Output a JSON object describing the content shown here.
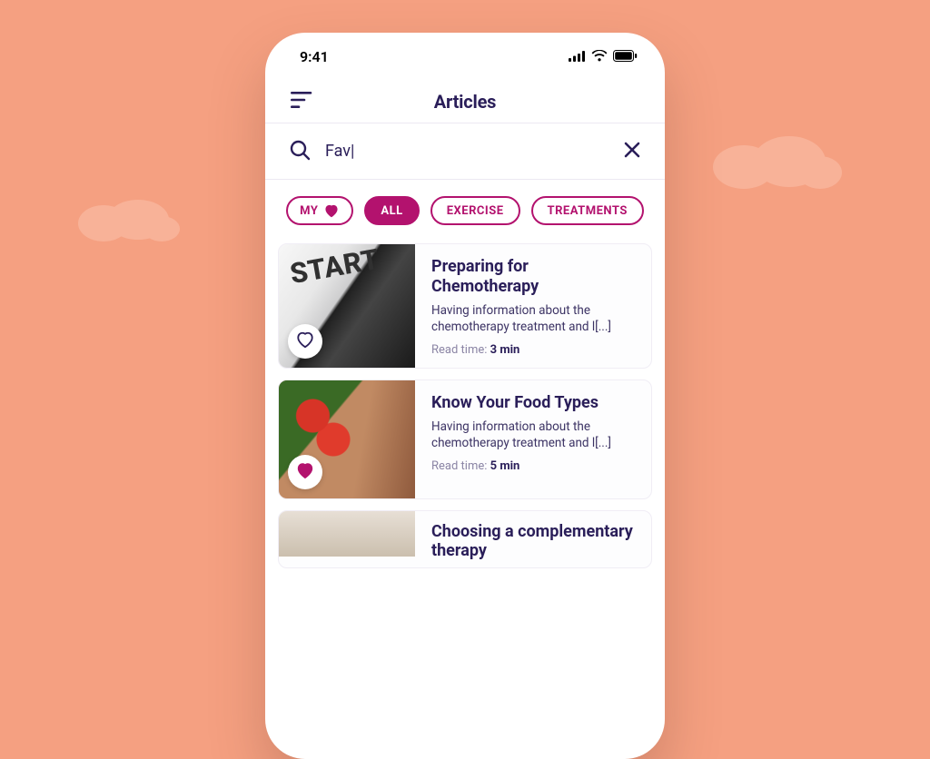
{
  "statusbar": {
    "time": "9:41"
  },
  "header": {
    "title": "Articles"
  },
  "search": {
    "value": "Fav|"
  },
  "filters": {
    "items": [
      {
        "label": "MY",
        "icon": "heart-icon",
        "active": false
      },
      {
        "label": "ALL",
        "active": true
      },
      {
        "label": "EXERCISE",
        "active": false
      },
      {
        "label": "TREATMENTS",
        "active": false
      }
    ]
  },
  "articles": [
    {
      "title": "Preparing for Chemotherapy",
      "excerpt": "Having information about the chemotherapy treatment and l[...]",
      "read_label": "Read time: ",
      "read_value": "3 min",
      "favorited": false,
      "thumb_kind": "start"
    },
    {
      "title": "Know Your Food Types",
      "excerpt": "Having information about the chemotherapy treatment and l[...]",
      "read_label": "Read time: ",
      "read_value": "5 min",
      "favorited": true,
      "thumb_kind": "food"
    },
    {
      "title": "Choosing a complementary therapy",
      "excerpt": "",
      "read_label": "",
      "read_value": "",
      "favorited": false,
      "thumb_kind": "plain"
    }
  ],
  "colors": {
    "accent": "#b3126e",
    "ink": "#2a1e59",
    "bg": "#f5a081"
  }
}
